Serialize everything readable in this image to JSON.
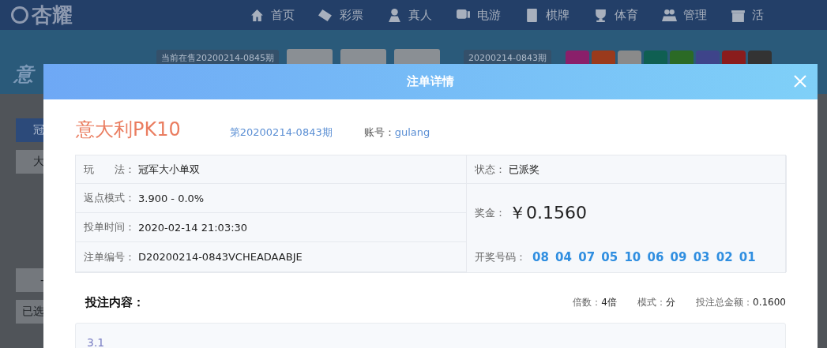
{
  "header": {
    "logo": "杏耀",
    "nav": [
      {
        "label": "首页"
      },
      {
        "label": "彩票"
      },
      {
        "label": "真人"
      },
      {
        "label": "电游"
      },
      {
        "label": "棋牌"
      },
      {
        "label": "体育"
      },
      {
        "label": "管理"
      },
      {
        "label": "活"
      }
    ]
  },
  "lottery_bar": {
    "title": "意",
    "current_period": "当前在售20200214-0845期",
    "last_period": "20200214-0843期",
    "balls": [
      {
        "color": "#8a1f6a"
      },
      {
        "color": "#9a3a1c"
      },
      {
        "color": "#8a8a8a"
      },
      {
        "color": "#0f5f52"
      },
      {
        "color": "#2b6a25"
      },
      {
        "color": "#3e448a"
      },
      {
        "color": "#8a1c1c"
      },
      {
        "color": "#333333"
      }
    ]
  },
  "side_fragments": [
    {
      "text": "冠"
    },
    {
      "text": "大"
    },
    {
      "text": "-"
    },
    {
      "text": "已选"
    }
  ],
  "modal": {
    "title": "注单详情",
    "lottery_name": "意大利PK10",
    "period": "第20200214-0843期",
    "account_label": "账号：",
    "account": "gulang",
    "details": [
      {
        "label": "玩　　法：",
        "value": "冠军大小单双"
      },
      {
        "label": "返点模式：",
        "value": "3.900 - 0.0%"
      },
      {
        "label": "投单时间：",
        "value": "2020-02-14 21:03:30"
      },
      {
        "label": "注单编号：",
        "value": "D20200214-0843VCHEADAABJE"
      }
    ],
    "status": {
      "label": "状态：",
      "value": "已派奖"
    },
    "prize": {
      "label": "奖金：",
      "value": "￥0.1560"
    },
    "draw": {
      "label": "开奖号码：",
      "numbers": [
        "08",
        "04",
        "07",
        "05",
        "10",
        "06",
        "09",
        "03",
        "02",
        "01"
      ]
    },
    "content_label": "投注内容：",
    "meta": [
      {
        "label": "倍数：",
        "value": "4倍"
      },
      {
        "label": "模式：",
        "value": "分"
      },
      {
        "label": "投注总金额：",
        "value": "0.1600"
      }
    ],
    "content": "3.1"
  }
}
